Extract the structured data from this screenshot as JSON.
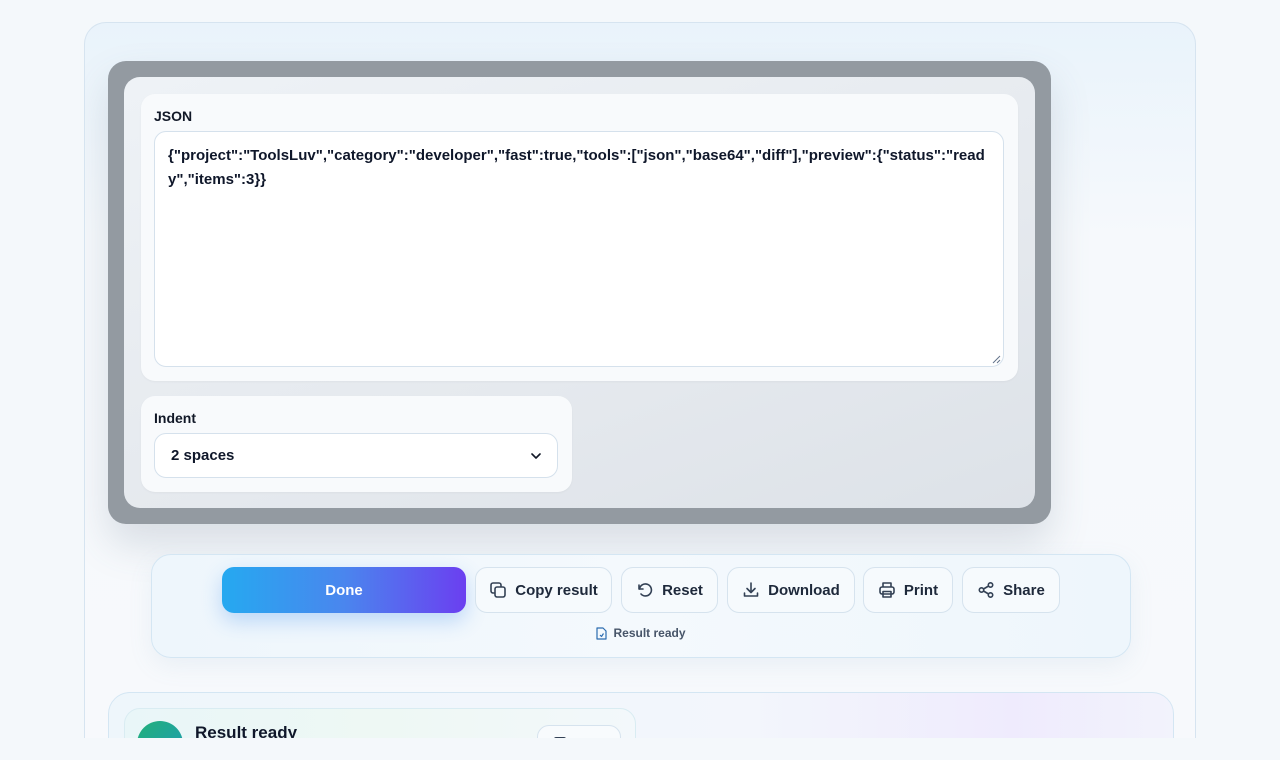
{
  "input_card": {
    "label": "JSON",
    "value": "{\"project\":\"ToolsLuv\",\"category\":\"developer\",\"fast\":true,\"tools\":[\"json\",\"base64\",\"diff\"],\"preview\":{\"status\":\"ready\",\"items\":3}}"
  },
  "indent_card": {
    "label": "Indent",
    "selected": "2 spaces"
  },
  "actions": {
    "done": "Done",
    "copy": "Copy result",
    "reset": "Reset",
    "download": "Download",
    "print": "Print",
    "share": "Share",
    "status": "Result ready"
  },
  "result": {
    "title": "Result ready",
    "check_icon": "check-icon"
  },
  "colors": {
    "accent_start": "#25a9f0",
    "accent_end": "#6b3ff0",
    "success": "#22b07a"
  }
}
